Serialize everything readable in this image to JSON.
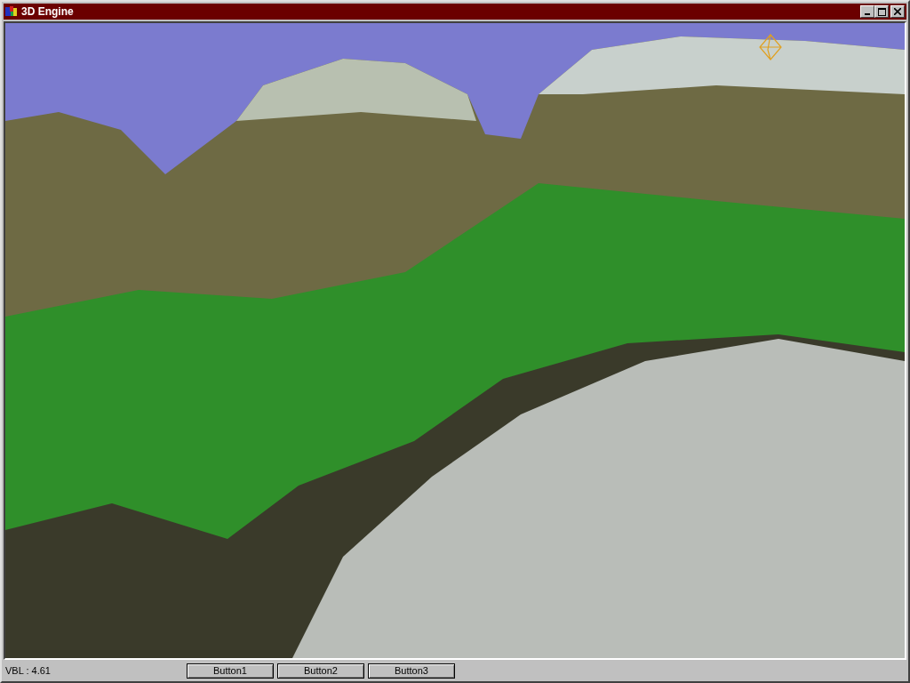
{
  "window": {
    "title": "3D Engine"
  },
  "status_bar": {
    "text": "VBL : 4.61",
    "buttons": [
      "Button1",
      "Button2",
      "Button3"
    ]
  }
}
